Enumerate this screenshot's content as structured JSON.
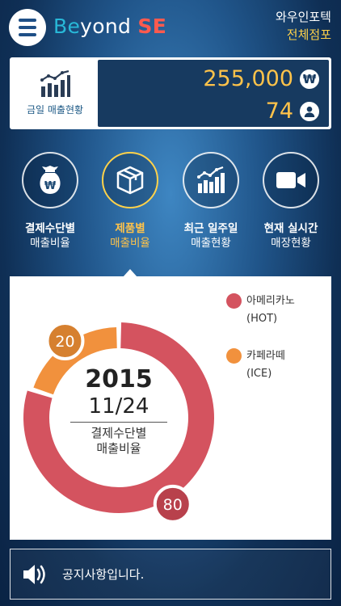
{
  "header": {
    "logo": {
      "part1": "Be",
      "part2": "yond ",
      "part3": "SE"
    },
    "company": "와우인포텍",
    "branch": "전체점포"
  },
  "sales": {
    "label": "금일 매출현황",
    "amount": "255,000",
    "currency_symbol": "₩",
    "visitors": "74"
  },
  "nav": [
    {
      "title": "결제수단별",
      "subtitle": "매출비율",
      "icon": "money-bag-icon",
      "active": false
    },
    {
      "title": "제품별",
      "subtitle": "매출비율",
      "icon": "box-icon",
      "active": true
    },
    {
      "title": "최근 일주일",
      "subtitle": "매출현황",
      "icon": "bar-chart-icon",
      "active": false
    },
    {
      "title": "현재 실시간",
      "subtitle": "매장현황",
      "icon": "video-camera-icon",
      "active": false
    }
  ],
  "chart_center": {
    "year": "2015",
    "date": "11/24",
    "line1": "결제수단별",
    "line2": "매출비율"
  },
  "chart_data": {
    "type": "pie",
    "categories": [
      "아메리카노 (HOT)",
      "카페라떼 (ICE)"
    ],
    "values": [
      80,
      20
    ],
    "colors": [
      "#d4535f",
      "#f1913d"
    ],
    "legend": [
      {
        "name": "아메리카노",
        "sub": "(HOT)",
        "color": "#d4535f"
      },
      {
        "name": "카페라떼",
        "sub": "(ICE)",
        "color": "#f1913d"
      }
    ]
  },
  "notice": {
    "text": "공지사항입니다.",
    "icon": "speaker-icon"
  }
}
